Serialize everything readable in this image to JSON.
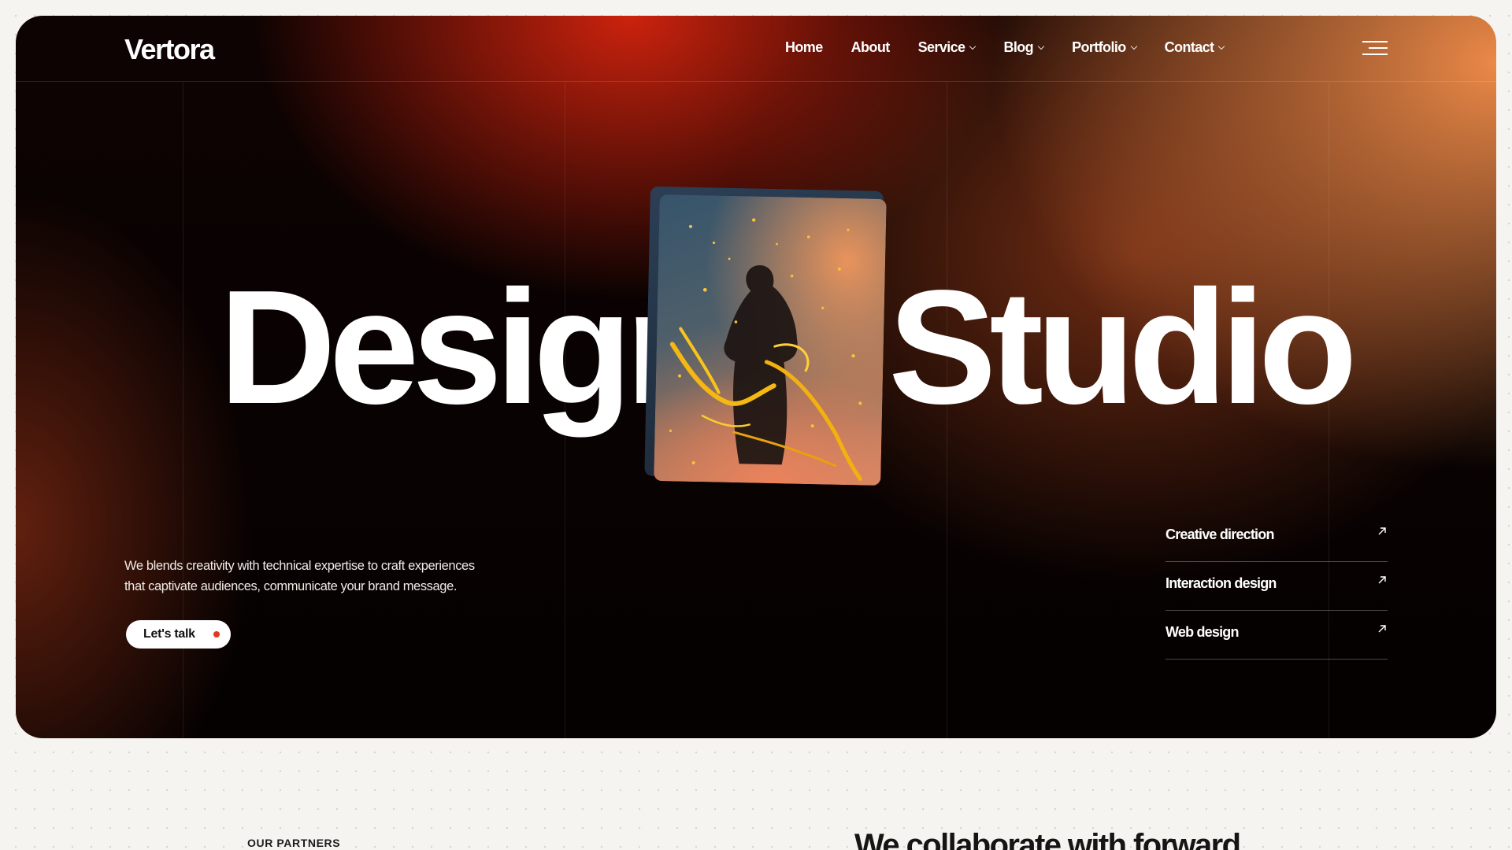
{
  "brand": {
    "logo": "Vertora"
  },
  "nav": {
    "items": [
      {
        "label": "Home",
        "has_dropdown": false
      },
      {
        "label": "About",
        "has_dropdown": false
      },
      {
        "label": "Service",
        "has_dropdown": true
      },
      {
        "label": "Blog",
        "has_dropdown": true
      },
      {
        "label": "Portfolio",
        "has_dropdown": true
      },
      {
        "label": "Contact",
        "has_dropdown": true
      }
    ],
    "menu_icon": "hamburger-menu-icon"
  },
  "hero": {
    "word_left": "Design",
    "word_right": "Studio",
    "description_line1": "We blends creativity with technical expertise to craft experiences",
    "description_line2": "that captivate audiences, communicate your brand message.",
    "cta_label": "Let's talk",
    "image_subject": "silhouette of person with golden paint splatter"
  },
  "services": [
    {
      "label": "Creative direction",
      "icon": "arrow-up-right-icon"
    },
    {
      "label": "Interaction design",
      "icon": "arrow-up-right-icon"
    },
    {
      "label": "Web design",
      "icon": "arrow-up-right-icon"
    }
  ],
  "partners": {
    "label": "OUR PARTNERS",
    "heading": "We collaborate with forward"
  },
  "colors": {
    "accent": "#e2381d",
    "hero_dark": "#050101",
    "hero_red": "#d6240e",
    "hero_orange": "#eb8948",
    "page_bg": "#f6f4f0"
  }
}
